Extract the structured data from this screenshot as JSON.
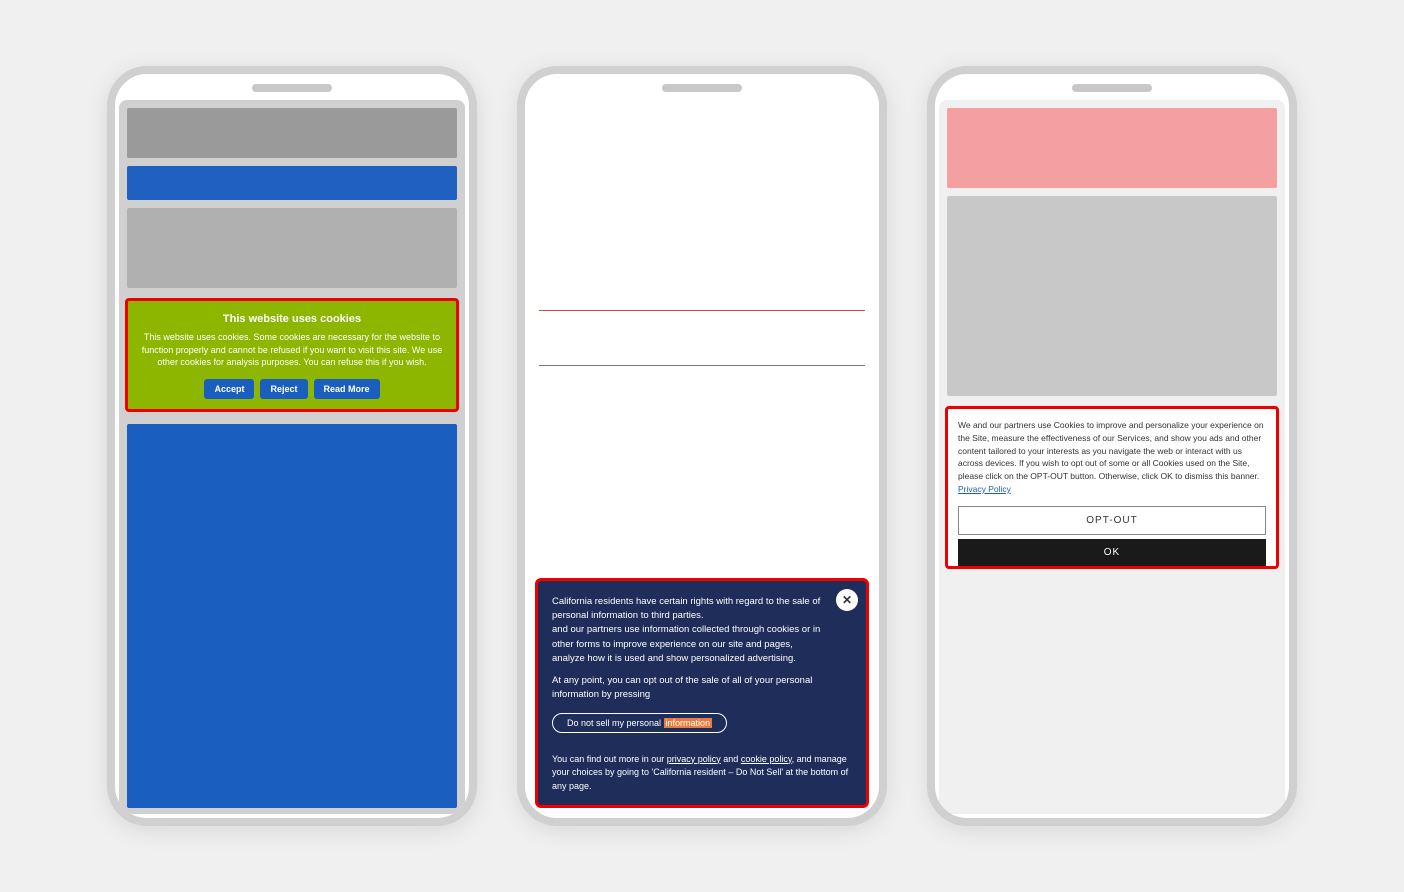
{
  "page": {
    "bg": "#f0f0f0"
  },
  "phone1": {
    "cookie_banner": {
      "title": "This website uses cookies",
      "text": "This website uses cookies. Some cookies are necessary for the website to function properly and cannot be refused if you want to visit this site. We use other cookies for analysis purposes. You can refuse this if you wish.",
      "btn_accept": "Accept",
      "btn_reject": "Reject",
      "btn_read_more": "Read More"
    }
  },
  "phone2": {
    "cookie_banner": {
      "text1": "California residents have certain rights with regard to the sale of personal information to third parties.",
      "text1b": "and our partners use information collected through cookies or in other forms to improve experience on our site and pages, analyze how it is used and show personalized advertising.",
      "text2": "At any point, you can opt out of the sale of all of your personal information by pressing",
      "btn_do_not_sell": "Do not sell my personal information",
      "btn_highlight": "information",
      "footer": "You can find out more in our privacy policy and cookie policy, and manage your choices by going to 'California resident – Do Not Sell' at the bottom of any page.",
      "close_icon": "✕"
    }
  },
  "phone3": {
    "cookie_banner": {
      "text": "We and our partners use Cookies to improve and personalize your experience on the Site, measure the effectiveness of our Services, and show you ads and other content tailored to your interests as you navigate the web or interact with us across devices. If you wish to opt out of some or all Cookies used on the Site, please click on the OPT-OUT button. Otherwise, click OK to dismiss this banner.",
      "privacy_link": "Privacy Policy",
      "btn_opt_out": "OPT-OUT",
      "btn_ok": "OK"
    }
  }
}
